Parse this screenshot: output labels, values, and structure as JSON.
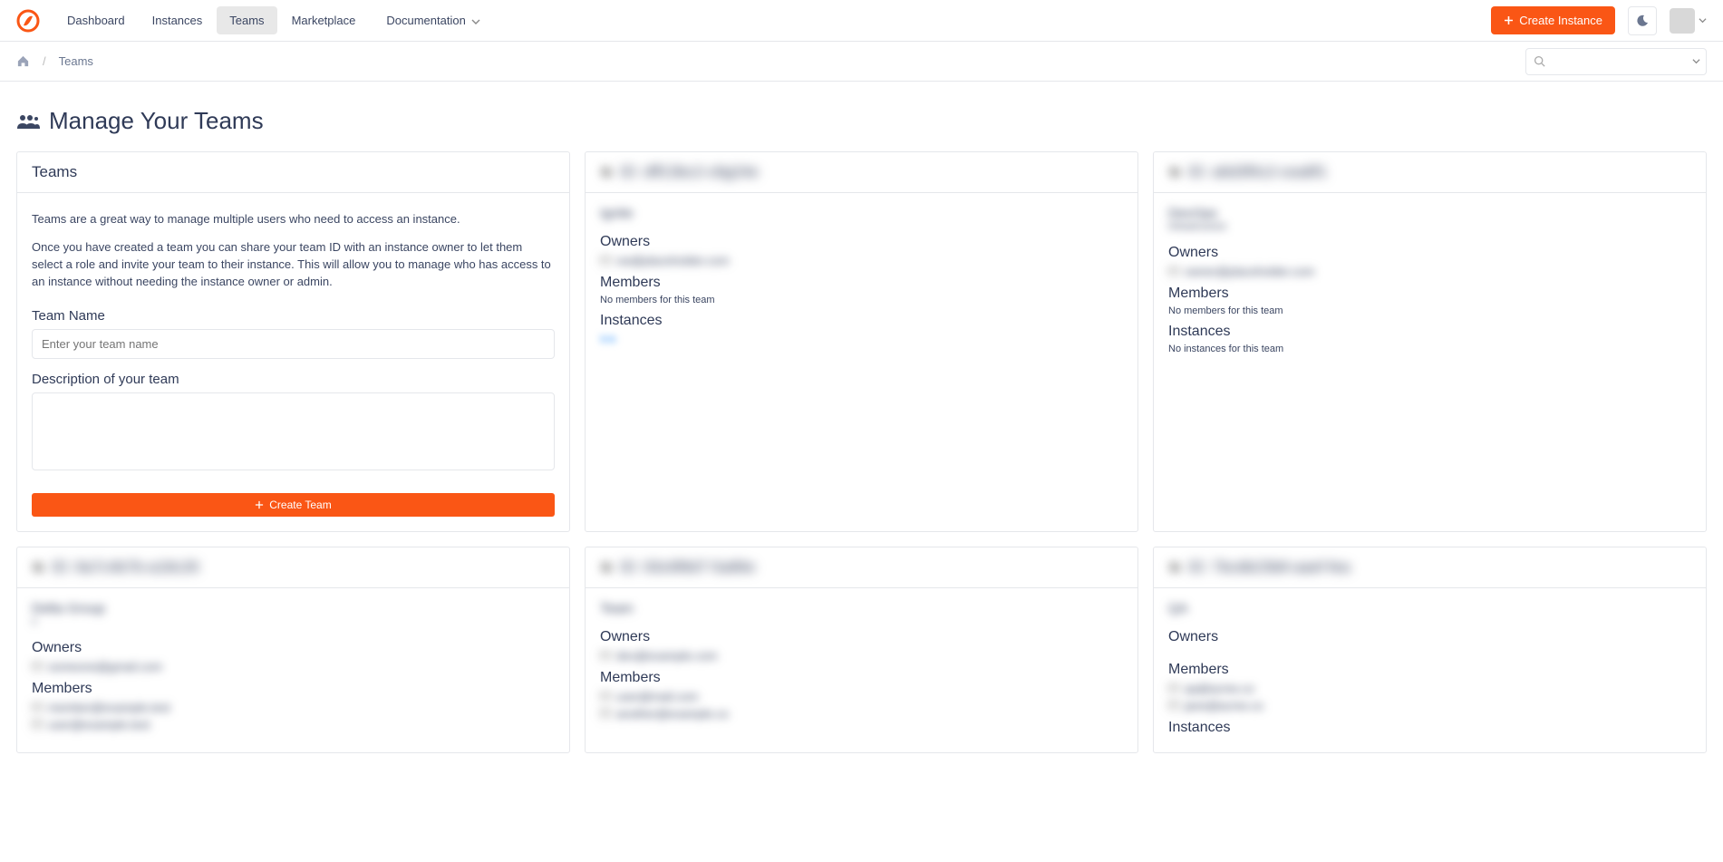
{
  "nav": {
    "links": [
      "Dashboard",
      "Instances",
      "Teams",
      "Marketplace"
    ],
    "active_index": 2,
    "documentation": "Documentation",
    "create_instance": "Create Instance"
  },
  "breadcrumb": {
    "current": "Teams"
  },
  "search": {
    "placeholder": ""
  },
  "page": {
    "title": "Manage Your Teams"
  },
  "create_card": {
    "header": "Teams",
    "desc1": "Teams are a great way to manage multiple users who need to access an instance.",
    "desc2": "Once you have created a team you can share your team ID with an instance owner to let them select a role and invite your team to their instance. This will allow you to manage who has access to an instance without needing the instance owner or admin.",
    "name_label": "Team Name",
    "name_placeholder": "Enter your team name",
    "desc_label": "Description of your team",
    "button": "Create Team"
  },
  "labels": {
    "owners": "Owners",
    "members": "Members",
    "instances": "Instances",
    "no_members": "No members for this team",
    "no_instances": "No instances for this team"
  },
  "teams": [
    {
      "id": "ID: dff13bc2-c8g24e",
      "name": "Ignite",
      "owners": [
        "ow@placeholder.com"
      ],
      "members": [],
      "instances_link": "link",
      "no_instances": false
    },
    {
      "id": "ID: a6d3f0c2-cea8f1",
      "name": "DevOps",
      "subline": "infrastructure",
      "owners": [
        "owner@placeholder.com"
      ],
      "members": [],
      "no_instances": true
    },
    {
      "id": "ID: 8a7c4b7b-a18c26",
      "name": "Delta Group",
      "subline": "x",
      "owners": [
        "someone@gmail.com"
      ],
      "members_preview": true
    },
    {
      "id": "ID: 93c6f8d7-5a86e",
      "name": "Team",
      "owners": [
        "dev@example.com"
      ],
      "members_list": [
        "user@mail.com",
        "another@example.co"
      ]
    },
    {
      "id": "ID: 7bcdb23b8-aaef-fea",
      "name": "QA",
      "owners_empty": true,
      "members_list": [
        "qa@acme.co",
        "jane@acme.co"
      ],
      "instances_heading": true
    }
  ]
}
